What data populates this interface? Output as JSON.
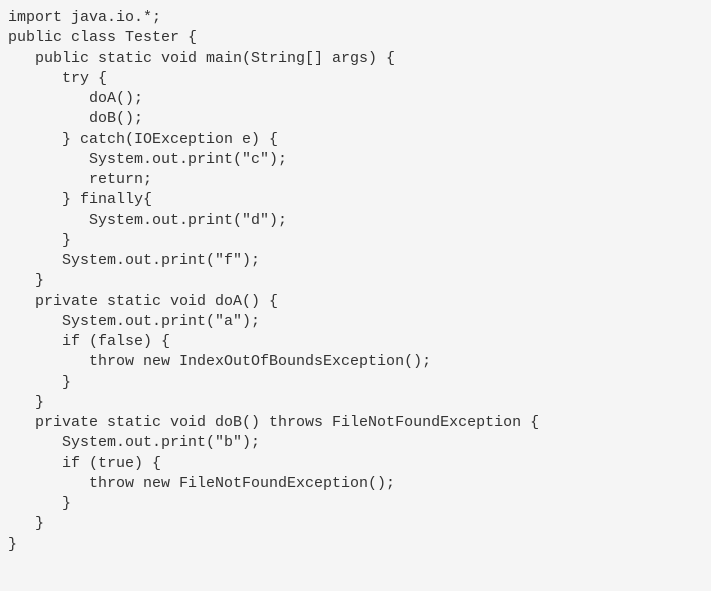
{
  "code": {
    "lines": [
      "import java.io.*;",
      "public class Tester {",
      "   public static void main(String[] args) {",
      "      try {",
      "         doA();",
      "         doB();",
      "      } catch(IOException e) {",
      "         System.out.print(\"c\");",
      "         return;",
      "      } finally{",
      "         System.out.print(\"d\");",
      "      }",
      "      System.out.print(\"f\");",
      "   }",
      "   private static void doA() {",
      "      System.out.print(\"a\");",
      "      if (false) {",
      "         throw new IndexOutOfBoundsException();",
      "      }",
      "   }",
      "   private static void doB() throws FileNotFoundException {",
      "      System.out.print(\"b\");",
      "      if (true) {",
      "         throw new FileNotFoundException();",
      "      }",
      "   }",
      "}"
    ]
  }
}
